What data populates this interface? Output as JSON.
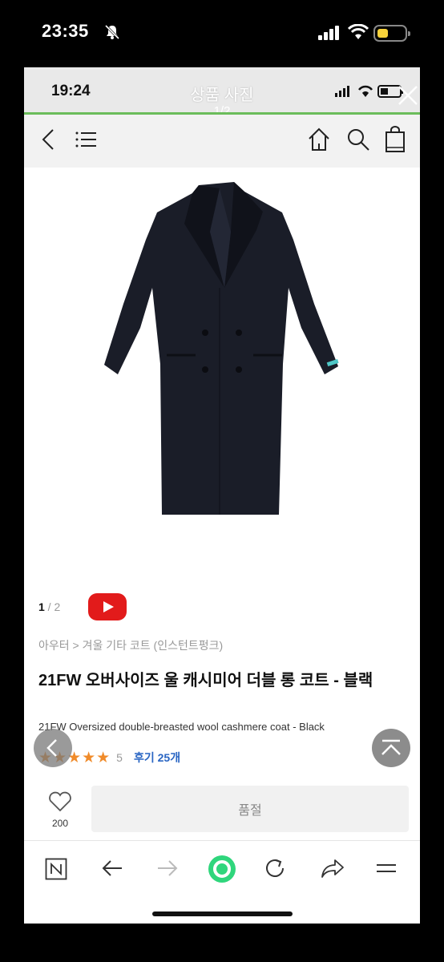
{
  "outer_status": {
    "time": "23:35"
  },
  "inner_status": {
    "time": "19:24"
  },
  "gallery": {
    "title": "상품 사진",
    "counter": "1/2"
  },
  "product": {
    "pager_current": "1",
    "pager_separator": " / ",
    "pager_total": "2",
    "breadcrumb": "아우터 > 겨울 기타 코트 (인스턴트펑크)",
    "title_ko": "21FW 오버사이즈 울 캐시미어 더블 롱 코트 - 블랙",
    "title_en": "21FW Oversized double-breasted wool cashmere coat - Black",
    "stars": "★★★★★",
    "rating_count": "5",
    "review_label": "후기 25개",
    "like_count": "200",
    "soldout_label": "품절"
  },
  "icons": {
    "header": [
      "back-arrow-icon",
      "menu-icon",
      "home-icon",
      "search-icon",
      "shopping-bag-icon"
    ],
    "toolbar": [
      "naver-n-icon",
      "back-icon",
      "forward-icon",
      "green-dot-icon",
      "refresh-icon",
      "share-icon",
      "menu-icon"
    ]
  },
  "colors": {
    "youtube_red": "#e21b1b",
    "star_orange": "#f08b2a",
    "review_blue": "#2965c3",
    "accent_green": "#6bbd5b",
    "battery_yellow": "#f7d23b",
    "coat": "#1a1d28"
  }
}
